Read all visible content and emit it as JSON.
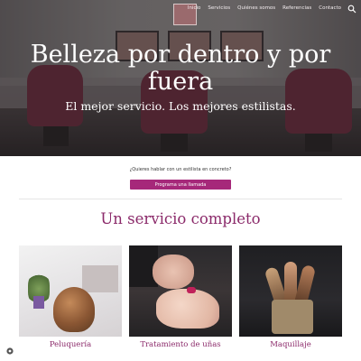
{
  "nav": {
    "items": [
      "Inicio",
      "Servicios",
      "Quiénes somos",
      "Referencias",
      "Contacto"
    ]
  },
  "hero": {
    "title": "Belleza por dentro y por fuera",
    "subtitle": "El mejor servicio. Los mejores estilistas."
  },
  "cta": {
    "text": "¿Quieres hablar con un estilista en concreto?",
    "button_label": "Programa una llamada"
  },
  "services": {
    "title": "Un servicio completo",
    "cards": [
      {
        "label": "Peluquería"
      },
      {
        "label": "Tratamiento de uñas"
      },
      {
        "label": "Maquillaje"
      }
    ]
  },
  "colors": {
    "accent": "#8b2a6a",
    "button": "#a6287a"
  },
  "icons": {
    "search": "search-icon",
    "help": "help-icon"
  }
}
